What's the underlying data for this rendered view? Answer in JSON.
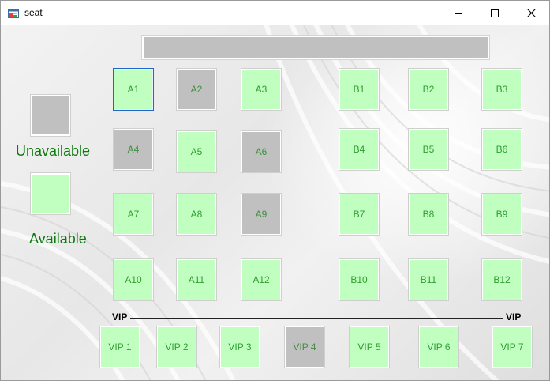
{
  "window": {
    "title": "seat",
    "icon": "app-window-icon"
  },
  "controls": {
    "minimize": "minimize-icon",
    "maximize": "maximize-icon",
    "close": "close-icon"
  },
  "legend": {
    "unavailable_label": "Unavailable",
    "available_label": "Available"
  },
  "colors": {
    "available": "#c0ffc0",
    "unavailable": "#c0c0c0",
    "text": "#2f9e2f",
    "legend_text": "#0b7a0b"
  },
  "seats": {
    "a": [
      {
        "label": "A1",
        "status": "available",
        "focused": true
      },
      {
        "label": "A2",
        "status": "unavailable"
      },
      {
        "label": "A3",
        "status": "available"
      },
      {
        "label": "A4",
        "status": "unavailable"
      },
      {
        "label": "A5",
        "status": "available"
      },
      {
        "label": "A6",
        "status": "unavailable"
      },
      {
        "label": "A7",
        "status": "available"
      },
      {
        "label": "A8",
        "status": "available"
      },
      {
        "label": "A9",
        "status": "unavailable"
      },
      {
        "label": "A10",
        "status": "available"
      },
      {
        "label": "A11",
        "status": "available"
      },
      {
        "label": "A12",
        "status": "available"
      }
    ],
    "b": [
      {
        "label": "B1",
        "status": "available"
      },
      {
        "label": "B2",
        "status": "available"
      },
      {
        "label": "B3",
        "status": "available"
      },
      {
        "label": "B4",
        "status": "available"
      },
      {
        "label": "B5",
        "status": "available"
      },
      {
        "label": "B6",
        "status": "available"
      },
      {
        "label": "B7",
        "status": "available"
      },
      {
        "label": "B8",
        "status": "available"
      },
      {
        "label": "B9",
        "status": "available"
      },
      {
        "label": "B10",
        "status": "available"
      },
      {
        "label": "B11",
        "status": "available"
      },
      {
        "label": "B12",
        "status": "available"
      }
    ],
    "vip_label_left": "VIP",
    "vip_label_right": "VIP",
    "vip": [
      {
        "label": "VIP 1",
        "status": "available"
      },
      {
        "label": "VIP 2",
        "status": "available"
      },
      {
        "label": "VIP 3",
        "status": "available"
      },
      {
        "label": "VIP 4",
        "status": "unavailable"
      },
      {
        "label": "VIP 5",
        "status": "available"
      },
      {
        "label": "VIP 6",
        "status": "available"
      },
      {
        "label": "VIP 7",
        "status": "available"
      }
    ]
  }
}
